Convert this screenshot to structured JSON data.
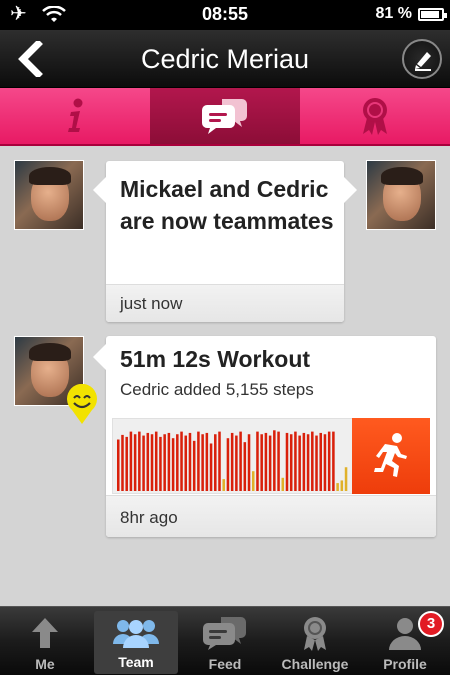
{
  "status_bar": {
    "time": "08:55",
    "battery": "81 %",
    "battery_level": 0.81
  },
  "nav": {
    "title": "Cedric Meriau"
  },
  "tabs": [
    {
      "name": "info-icon",
      "selected": false
    },
    {
      "name": "chat-bubbles-icon",
      "selected": true
    },
    {
      "name": "ribbon-award-icon",
      "selected": false
    }
  ],
  "feed": {
    "teammates_message": "Mickael and Cedric are now teammates",
    "teammates_time": "just now",
    "workout_title": "51m 12s Workout",
    "workout_subtitle": "Cedric added 5,155 steps",
    "workout_time": "8hr ago"
  },
  "colors": {
    "accent": "#e81a64",
    "active_bar": "#d9200b",
    "idle_bar": "#e0b12a",
    "run_button": "#ee3d0b"
  },
  "chart_data": {
    "type": "bar",
    "values": [
      0.78,
      0.85,
      0.82,
      0.9,
      0.86,
      0.9,
      0.84,
      0.88,
      0.86,
      0.9,
      0.82,
      0.86,
      0.88,
      0.8,
      0.86,
      0.9,
      0.84,
      0.88,
      0.76,
      0.9,
      0.86,
      0.88,
      0.72,
      0.86,
      0.9,
      0.18,
      0.8,
      0.88,
      0.84,
      0.9,
      0.74,
      0.86,
      0.3,
      0.9,
      0.86,
      0.88,
      0.84,
      0.92,
      0.9,
      0.2,
      0.88,
      0.86,
      0.9,
      0.84,
      0.88,
      0.86,
      0.9,
      0.84,
      0.88,
      0.86,
      0.9,
      0.9,
      0.12,
      0.16,
      0.36
    ],
    "idle_indices": [
      25,
      32,
      39,
      52,
      53,
      54
    ]
  },
  "tab_bar": {
    "items": [
      {
        "label": "Me"
      },
      {
        "label": "Team"
      },
      {
        "label": "Feed"
      },
      {
        "label": "Challenge"
      },
      {
        "label": "Profile"
      }
    ],
    "profile_badge": "3"
  }
}
